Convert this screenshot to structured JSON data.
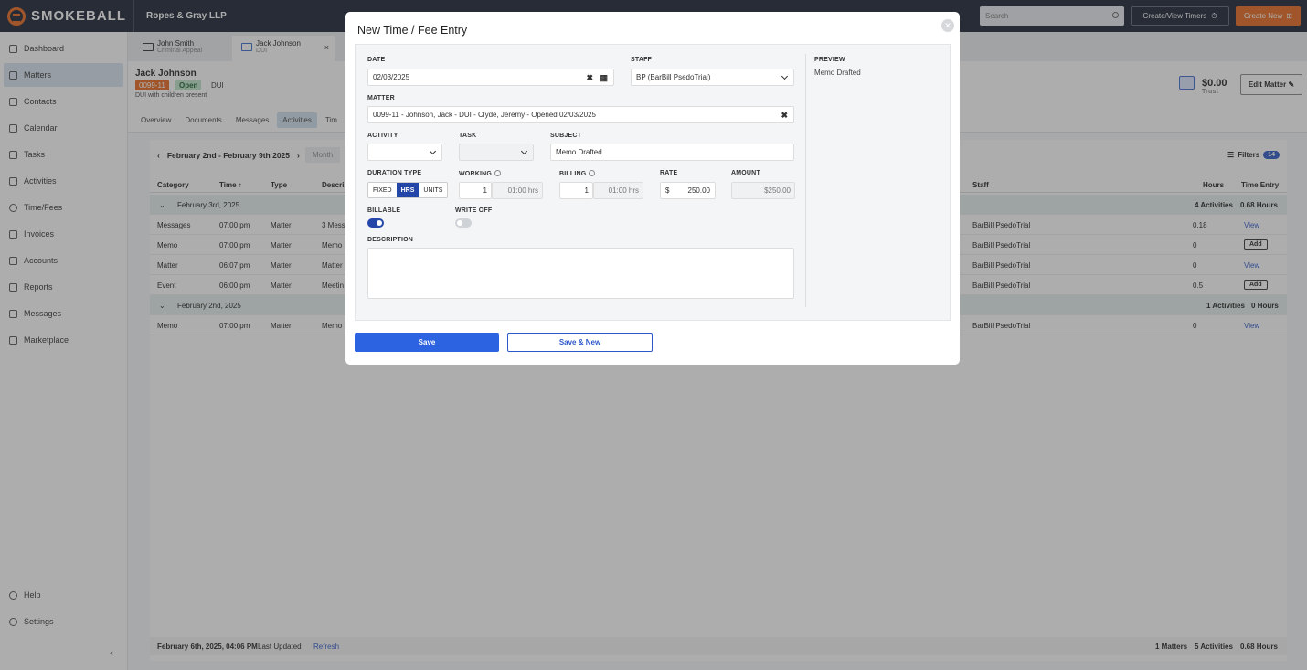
{
  "topbar": {
    "brand": "SMOKEBALL",
    "firm": "Ropes & Gray LLP",
    "search_placeholder": "Search",
    "timers_label": "Create/View Timers",
    "create_label": "Create New"
  },
  "sidebar": {
    "items": [
      {
        "label": "Dashboard",
        "icon": "dashboard-icon"
      },
      {
        "label": "Matters",
        "icon": "matters-icon"
      },
      {
        "label": "Contacts",
        "icon": "contacts-icon"
      },
      {
        "label": "Calendar",
        "icon": "calendar-icon"
      },
      {
        "label": "Tasks",
        "icon": "tasks-icon"
      },
      {
        "label": "Activities",
        "icon": "activities-icon"
      },
      {
        "label": "Time/Fees",
        "icon": "clock-icon"
      },
      {
        "label": "Invoices",
        "icon": "invoice-icon"
      },
      {
        "label": "Accounts",
        "icon": "accounts-icon"
      },
      {
        "label": "Reports",
        "icon": "reports-icon"
      },
      {
        "label": "Messages",
        "icon": "messages-icon"
      },
      {
        "label": "Marketplace",
        "icon": "marketplace-icon"
      }
    ],
    "bottom": [
      {
        "label": "Help"
      },
      {
        "label": "Settings"
      }
    ]
  },
  "matter_tabs": [
    {
      "title": "John Smith",
      "sub": "Criminal Appeal"
    },
    {
      "title": "Jack Johnson",
      "sub": "DUI"
    }
  ],
  "matter": {
    "name": "Jack Johnson",
    "number": "0099-11",
    "status": "Open",
    "type": "DUI",
    "description": "DUI with children present",
    "trust_amount": "$0.00",
    "trust_label": "Trust",
    "edit_label": "Edit Matter"
  },
  "subtabs": [
    "Overview",
    "Documents",
    "Messages",
    "Activities",
    "Tim"
  ],
  "activities": {
    "range": "February 2nd - February 9th 2025",
    "view": "Month",
    "filters_label": "Filters",
    "filters_count": "14",
    "headers": {
      "category": "Category",
      "time": "Time ↑",
      "type": "Type",
      "desc": "Descrip",
      "staff": "Staff",
      "hours": "Hours",
      "entry": "Time Entry"
    },
    "groups": [
      {
        "date": "February 3rd, 2025",
        "count": "4 Activities",
        "hours": "0.68 Hours",
        "rows": [
          {
            "category": "Messages",
            "time": "07:00 pm",
            "type": "Matter",
            "desc": "3 Mess",
            "staff": "BarBill PsedoTrial",
            "hours": "0.18",
            "action": "View"
          },
          {
            "category": "Memo",
            "time": "07:00 pm",
            "type": "Matter",
            "desc": "Memo",
            "staff": "BarBill PsedoTrial",
            "hours": "0",
            "action": "Add"
          },
          {
            "category": "Matter",
            "time": "06:07 pm",
            "type": "Matter",
            "desc": "Matter",
            "staff": "BarBill PsedoTrial",
            "hours": "0",
            "action": "View"
          },
          {
            "category": "Event",
            "time": "06:00 pm",
            "type": "Matter",
            "desc": "Meetin",
            "staff": "BarBill PsedoTrial",
            "hours": "0.5",
            "action": "Add"
          }
        ]
      },
      {
        "date": "February 2nd, 2025",
        "count": "1 Activities",
        "hours": "0 Hours",
        "rows": [
          {
            "category": "Memo",
            "time": "07:00 pm",
            "type": "Matter",
            "desc": "Memo",
            "staff": "BarBill PsedoTrial",
            "hours": "0",
            "action": "View"
          }
        ]
      }
    ],
    "footer": {
      "updated": "February 6th, 2025, 04:06 PM",
      "updated_suffix": "Last Updated",
      "refresh": "Refresh",
      "matters": "1 Matters",
      "activities": "5 Activities",
      "hours": "0.68 Hours"
    }
  },
  "modal": {
    "title": "New Time / Fee Entry",
    "date_label": "DATE",
    "date_value": "02/03/2025",
    "staff_label": "STAFF",
    "staff_value": "BP (BarBill PsedoTrial)",
    "matter_label": "MATTER",
    "matter_value": "0099-11 - Johnson, Jack - DUI - Clyde, Jeremy - Opened 02/03/2025",
    "activity_label": "ACTIVITY",
    "task_label": "TASK",
    "subject_label": "SUBJECT",
    "subject_value": "Memo Drafted",
    "duration_label": "DURATION TYPE",
    "duration_options": [
      "FIXED",
      "HRS",
      "UNITS"
    ],
    "duration_selected": "HRS",
    "working_label": "WORKING",
    "working_value": "1",
    "working_hrs": "01:00 hrs",
    "billing_label": "BILLING",
    "billing_value": "1",
    "billing_hrs": "01:00 hrs",
    "rate_label": "RATE",
    "rate_currency": "$",
    "rate_value": "250.00",
    "amount_label": "AMOUNT",
    "amount_value": "$250.00",
    "billable_label": "BILLABLE",
    "billable_on": true,
    "writeoff_label": "WRITE OFF",
    "writeoff_on": false,
    "description_label": "DESCRIPTION",
    "description_value": "",
    "preview_label": "PREVIEW",
    "preview_value": "Memo Drafted",
    "save_label": "Save",
    "save_new_label": "Save & New"
  }
}
